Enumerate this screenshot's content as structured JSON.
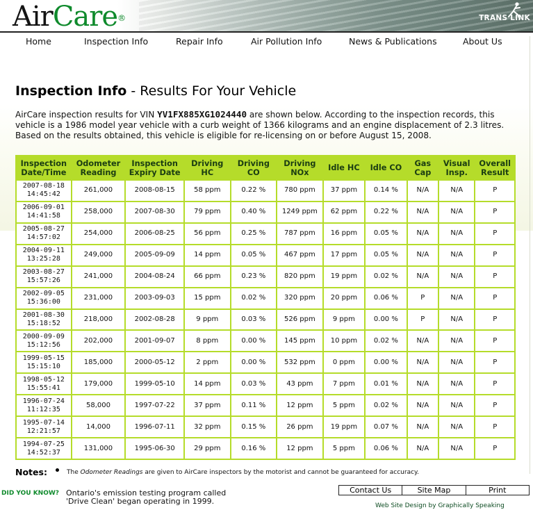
{
  "header": {
    "logo_air": "Air",
    "logo_care": "Care",
    "logo_reg": "®",
    "translink": "TRANS LINK"
  },
  "nav": [
    {
      "label": "Home"
    },
    {
      "label": "Inspection Info"
    },
    {
      "label": "Repair Info"
    },
    {
      "label": "Air Pollution Info"
    },
    {
      "label": "News & Publications"
    },
    {
      "label": "About Us"
    }
  ],
  "page": {
    "title_bold": "Inspection Info",
    "title_rest": " - Results For Your Vehicle",
    "intro_before": "AirCare inspection results for VIN ",
    "vin": "YV1FX885XG1024440",
    "intro_after": " are shown below. According to the inspection records, this vehicle is a 1986 model year vehicle with a curb weight of 1366 kilograms and an engine displacement of 2.3 litres. Based on the results obtained, this vehicle is eligible for re-licensing on or before August 15, 2008."
  },
  "table": {
    "headers": [
      "Inspection Date/Time",
      "Odometer Reading",
      "Inspection Expiry Date",
      "Driving HC",
      "Driving CO",
      "Driving NOx",
      "Idle HC",
      "Idle CO",
      "Gas Cap",
      "Visual Insp.",
      "Overall Result"
    ],
    "rows": [
      {
        "date": "2007-08-18",
        "time": "14:45:42",
        "odometer": "261,000",
        "expiry": "2008-08-15",
        "driving_hc": "58 ppm",
        "driving_co": "0.22 %",
        "driving_nox": "780 ppm",
        "idle_hc": "37 ppm",
        "idle_co": "0.14 %",
        "gas_cap": "N/A",
        "visual": "N/A",
        "result": "P"
      },
      {
        "date": "2006-09-01",
        "time": "14:41:58",
        "odometer": "258,000",
        "expiry": "2007-08-30",
        "driving_hc": "79 ppm",
        "driving_co": "0.40 %",
        "driving_nox": "1249 ppm",
        "idle_hc": "62 ppm",
        "idle_co": "0.22 %",
        "gas_cap": "N/A",
        "visual": "N/A",
        "result": "P"
      },
      {
        "date": "2005-08-27",
        "time": "14:57:02",
        "odometer": "254,000",
        "expiry": "2006-08-25",
        "driving_hc": "56 ppm",
        "driving_co": "0.25 %",
        "driving_nox": "787 ppm",
        "idle_hc": "16 ppm",
        "idle_co": "0.05 %",
        "gas_cap": "N/A",
        "visual": "N/A",
        "result": "P"
      },
      {
        "date": "2004-09-11",
        "time": "13:25:28",
        "odometer": "249,000",
        "expiry": "2005-09-09",
        "driving_hc": "14 ppm",
        "driving_co": "0.05 %",
        "driving_nox": "467 ppm",
        "idle_hc": "17 ppm",
        "idle_co": "0.05 %",
        "gas_cap": "N/A",
        "visual": "N/A",
        "result": "P"
      },
      {
        "date": "2003-08-27",
        "time": "15:57:26",
        "odometer": "241,000",
        "expiry": "2004-08-24",
        "driving_hc": "66 ppm",
        "driving_co": "0.23 %",
        "driving_nox": "820 ppm",
        "idle_hc": "19 ppm",
        "idle_co": "0.02 %",
        "gas_cap": "N/A",
        "visual": "N/A",
        "result": "P"
      },
      {
        "date": "2002-09-05",
        "time": "15:36:00",
        "odometer": "231,000",
        "expiry": "2003-09-03",
        "driving_hc": "15 ppm",
        "driving_co": "0.02 %",
        "driving_nox": "320 ppm",
        "idle_hc": "20 ppm",
        "idle_co": "0.06 %",
        "gas_cap": "P",
        "visual": "N/A",
        "result": "P"
      },
      {
        "date": "2001-08-30",
        "time": "15:18:52",
        "odometer": "218,000",
        "expiry": "2002-08-28",
        "driving_hc": "9 ppm",
        "driving_co": "0.03 %",
        "driving_nox": "526 ppm",
        "idle_hc": "9 ppm",
        "idle_co": "0.00 %",
        "gas_cap": "P",
        "visual": "N/A",
        "result": "P"
      },
      {
        "date": "2000-09-09",
        "time": "15:12:56",
        "odometer": "202,000",
        "expiry": "2001-09-07",
        "driving_hc": "8 ppm",
        "driving_co": "0.00 %",
        "driving_nox": "145 ppm",
        "idle_hc": "10 ppm",
        "idle_co": "0.02 %",
        "gas_cap": "N/A",
        "visual": "N/A",
        "result": "P"
      },
      {
        "date": "1999-05-15",
        "time": "15:15:10",
        "odometer": "185,000",
        "expiry": "2000-05-12",
        "driving_hc": "2 ppm",
        "driving_co": "0.00 %",
        "driving_nox": "532 ppm",
        "idle_hc": "0 ppm",
        "idle_co": "0.00 %",
        "gas_cap": "N/A",
        "visual": "N/A",
        "result": "P"
      },
      {
        "date": "1998-05-12",
        "time": "15:55:41",
        "odometer": "179,000",
        "expiry": "1999-05-10",
        "driving_hc": "14 ppm",
        "driving_co": "0.03 %",
        "driving_nox": "43 ppm",
        "idle_hc": "7 ppm",
        "idle_co": "0.01 %",
        "gas_cap": "N/A",
        "visual": "N/A",
        "result": "P"
      },
      {
        "date": "1996-07-24",
        "time": "11:12:35",
        "odometer": "58,000",
        "expiry": "1997-07-22",
        "driving_hc": "37 ppm",
        "driving_co": "0.11 %",
        "driving_nox": "12 ppm",
        "idle_hc": "5 ppm",
        "idle_co": "0.02 %",
        "gas_cap": "N/A",
        "visual": "N/A",
        "result": "P"
      },
      {
        "date": "1995-07-14",
        "time": "12:21:57",
        "odometer": "14,000",
        "expiry": "1996-07-11",
        "driving_hc": "32 ppm",
        "driving_co": "0.15 %",
        "driving_nox": "26 ppm",
        "idle_hc": "19 ppm",
        "idle_co": "0.07 %",
        "gas_cap": "N/A",
        "visual": "N/A",
        "result": "P"
      },
      {
        "date": "1994-07-25",
        "time": "14:52:37",
        "odometer": "131,000",
        "expiry": "1995-06-30",
        "driving_hc": "29 ppm",
        "driving_co": "0.16 %",
        "driving_nox": "12 ppm",
        "idle_hc": "5 ppm",
        "idle_co": "0.06 %",
        "gas_cap": "N/A",
        "visual": "N/A",
        "result": "P"
      }
    ]
  },
  "notes": {
    "label": "Notes:",
    "em": "Odometer Readings",
    "before": "The ",
    "after": " are given to AirCare inspectors by the motorist and cannot be guaranteed for accuracy."
  },
  "footer": {
    "dyk_label": "DID YOU KNOW?",
    "dyk_line1": "Ontario's emission testing program called",
    "dyk_line2": "'Drive Clean' began operating in 1999.",
    "links": [
      {
        "label": "Contact Us"
      },
      {
        "label": "Site Map"
      },
      {
        "label": "Print"
      }
    ],
    "credit": "Web Site Design by Graphically Speaking"
  },
  "colors": {
    "brand_green": "#0f8a2c",
    "table_accent": "#b5dc2a",
    "header_text": "#1b3d12"
  }
}
